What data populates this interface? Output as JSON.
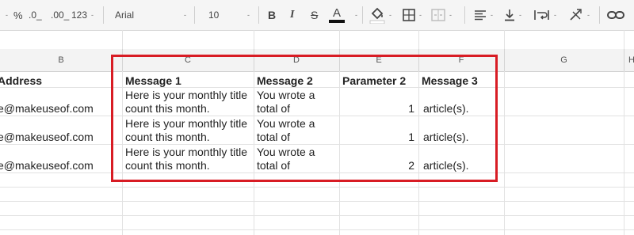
{
  "toolbar": {
    "percent": "%",
    "dec_decrease": ".0_",
    "dec_increase": ".00_",
    "more_formats": "123",
    "font": "Arial",
    "font_size": "10",
    "bold": "B",
    "italic": "I",
    "strike": "S",
    "text_color": "A",
    "caret": "-"
  },
  "columns": [
    "B",
    "C",
    "D",
    "E",
    "F",
    "G",
    "H"
  ],
  "header_row": {
    "b": "Address",
    "c": "Message 1",
    "d": "Message 2",
    "e": "Parameter 2",
    "f": "Message 3"
  },
  "rows": [
    {
      "b": "e@makeuseof.com",
      "c1": "Here is your monthly title",
      "c2": "count this month.",
      "d1": "You wrote a",
      "d2": "total of",
      "e": "1",
      "f": "article(s)."
    },
    {
      "b": "e@makeuseof.com",
      "c1": "Here is your monthly title",
      "c2": "count this month.",
      "d1": "You wrote a",
      "d2": "total of",
      "e": "1",
      "f": "article(s)."
    },
    {
      "b": "e@makeuseof.com",
      "c1": "Here is your monthly title",
      "c2": "count this month.",
      "d1": "You wrote a",
      "d2": "total of",
      "e": "2",
      "f": "article(s)."
    }
  ],
  "colors": {
    "highlight": "#d81c24",
    "toolbar_bg": "#f5f5f5",
    "header_bg": "#f3f3f3",
    "grid_line": "#e2e2e2"
  }
}
